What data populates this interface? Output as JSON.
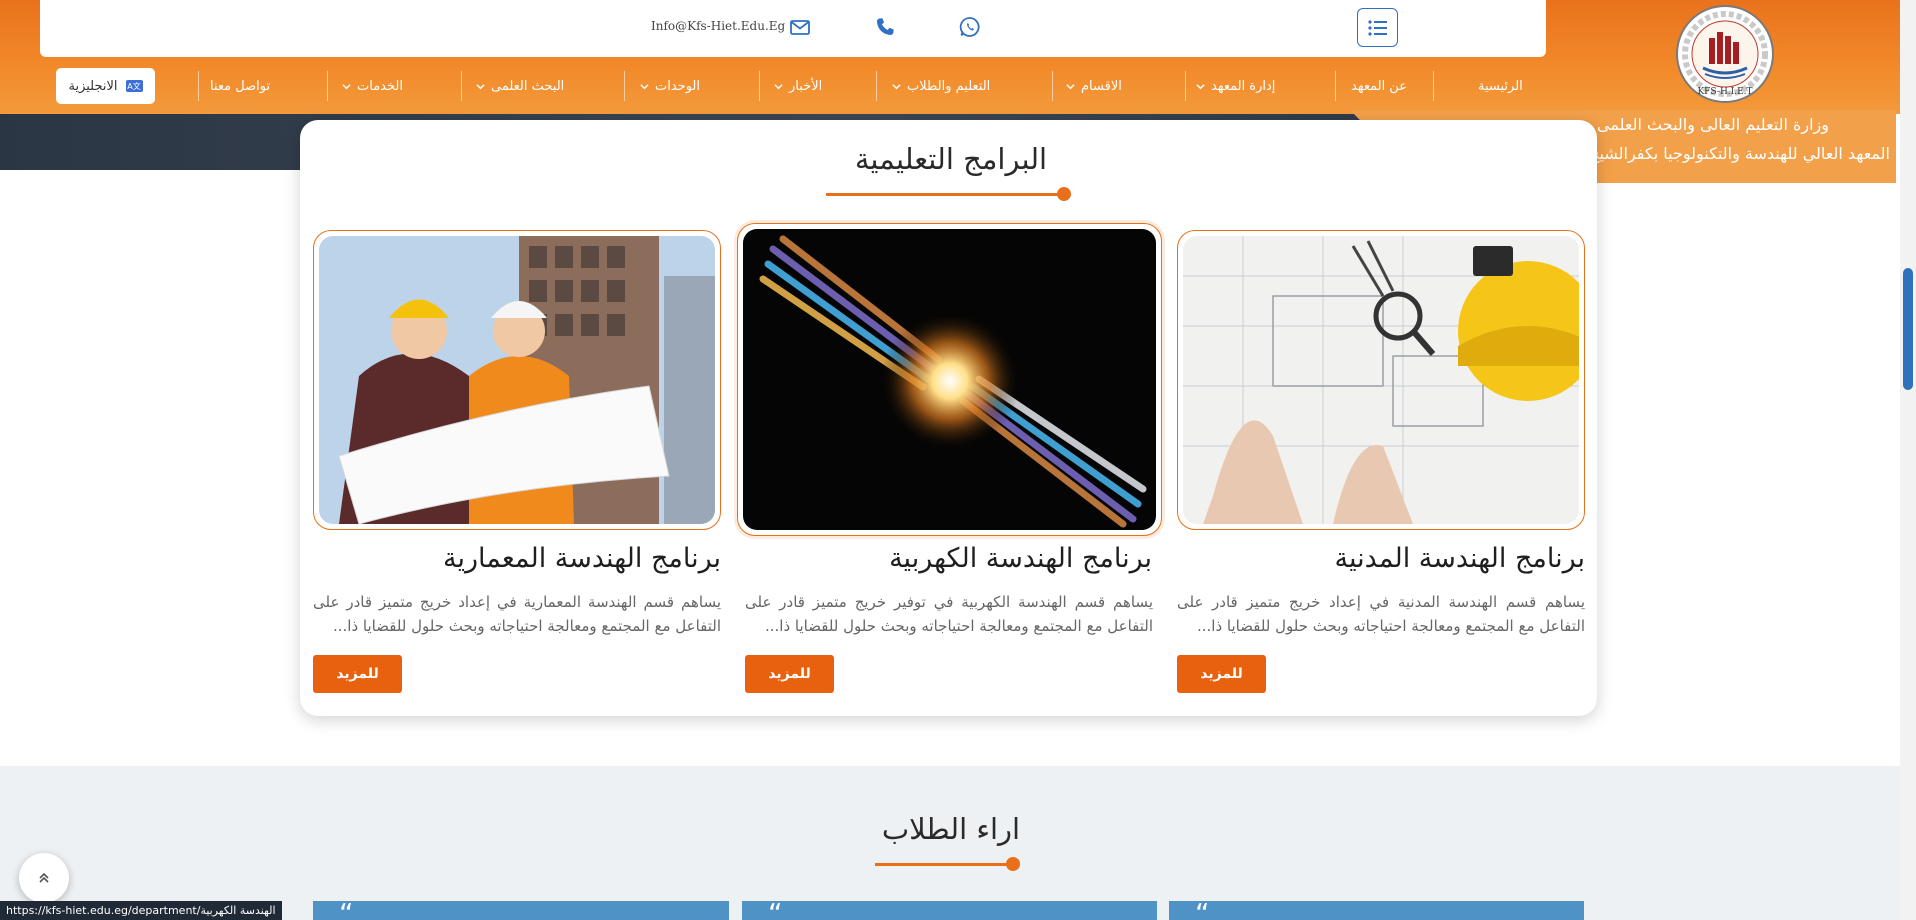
{
  "header": {
    "contact_email": "Info@Kfs-Hiet.Edu.Eg",
    "brand_line1": "وزارة التعليم العالى والبحث العلمى",
    "brand_line2": "المعهد العالي للهندسة والتكنولوجيا بكفرالشيخ",
    "logo_caption": "KFS-H.I.E.T",
    "icons": {
      "email": "envelope-icon",
      "phone": "phone-icon",
      "whatsapp": "whatsapp-icon",
      "menu": "list-icon"
    }
  },
  "nav": {
    "items": [
      {
        "label": "الرئيسية",
        "dropdown": false
      },
      {
        "label": "عن المعهد",
        "dropdown": false
      },
      {
        "label": "إدارة المعهد",
        "dropdown": true
      },
      {
        "label": "الاقسام",
        "dropdown": true
      },
      {
        "label": "التعليم والطلاب",
        "dropdown": true
      },
      {
        "label": "الأخبار",
        "dropdown": true
      },
      {
        "label": "الوحدات",
        "dropdown": true
      },
      {
        "label": "البحث العلمى",
        "dropdown": true
      },
      {
        "label": "الخدمات",
        "dropdown": true
      },
      {
        "label": "تواصل معنا",
        "dropdown": false
      }
    ],
    "language_button": "الانجليزية"
  },
  "programs": {
    "title": "البرامج التعليمية",
    "items": [
      {
        "title": "برنامج الهندسة المدنية",
        "description": "يساهم قسم الهندسة المدنية في إعداد خريج متميز قادر على التفاعل مع المجتمع ومعالجة احتياجاته وبحث حلول للقضايا ذا...",
        "button": "للمزيد"
      },
      {
        "title": "برنامج الهندسة الكهربية",
        "description": "يساهم قسم الهندسة الكهربية في توفير خريج متميز قادر على التفاعل مع المجتمع ومعالجة احتياجاته وبحث حلول للقضايا ذا...",
        "button": "للمزيد"
      },
      {
        "title": "برنامج الهندسة المعمارية",
        "description": "يساهم قسم الهندسة المعمارية في إعداد خريج متميز قادر على التفاعل مع المجتمع ومعالجة احتياجاته وبحث حلول للقضايا ذا...",
        "button": "للمزيد"
      }
    ]
  },
  "opinions": {
    "title": "اراء الطلاب",
    "quote_mark": "“"
  },
  "status_bar": {
    "url": "https://kfs-hiet.edu.eg/department/الهندسة الكهربية"
  },
  "colors": {
    "accent": "#e8701a",
    "button": "#e8610f",
    "header_orange": "#f28a2a",
    "brand_panel": "#f3a04a",
    "scroll_thumb": "#2e72bd"
  }
}
